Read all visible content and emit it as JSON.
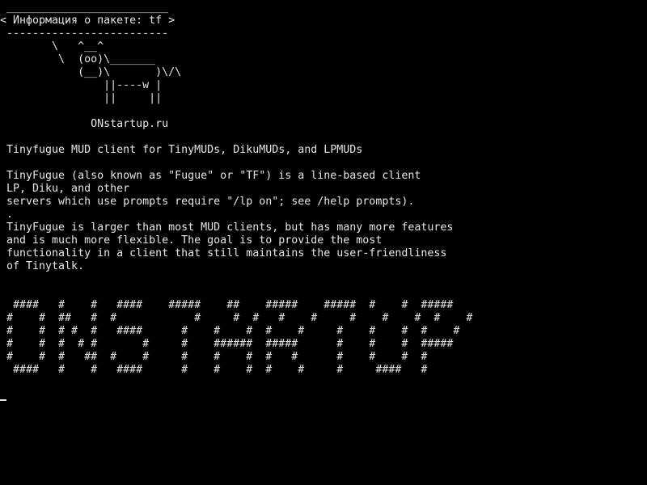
{
  "terminal": {
    "lines": [
      " _________________________",
      "< Информация о пакете: tf >",
      " -------------------------",
      "        \\   ^__^",
      "         \\  (oo)\\_______",
      "            (__)\\       )\\/\\",
      "                ||----w |",
      "                ||     ||",
      "",
      "              ONstartup.ru",
      "",
      " Tinyfugue MUD client for TinyMUDs, DikuMUDs, and LPMUDs",
      "",
      " TinyFugue (also known as \"Fugue\" or \"TF\") is a line-based client",
      " LP, Diku, and other",
      " servers which use prompts require \"/lp on\"; see /help prompts).",
      " .",
      " TinyFugue is larger than most MUD clients, but has many more features",
      " and is much more flexible. The goal is to provide the most",
      " functionality in a client that still maintains the user-friendliness",
      " of Tinytalk.",
      "",
      "",
      "  ####   #    #   ####    #####    ##    #####    #####  #    #  #####",
      " #    #  ##   #  #            #     #  #   #    #     #    #    #  #    #",
      " #    #  # #  #   ####      #    #    #  #    #     #    #    #  #    #",
      " #    #  #  # #       #     #    ######  #####      #    #    #  #####",
      " #    #  #   ##  #    #     #    #    #  #   #      #    #    #  #",
      "  ####   #    #   ####      #    #    #  #    #     #     ####   #"
    ]
  }
}
